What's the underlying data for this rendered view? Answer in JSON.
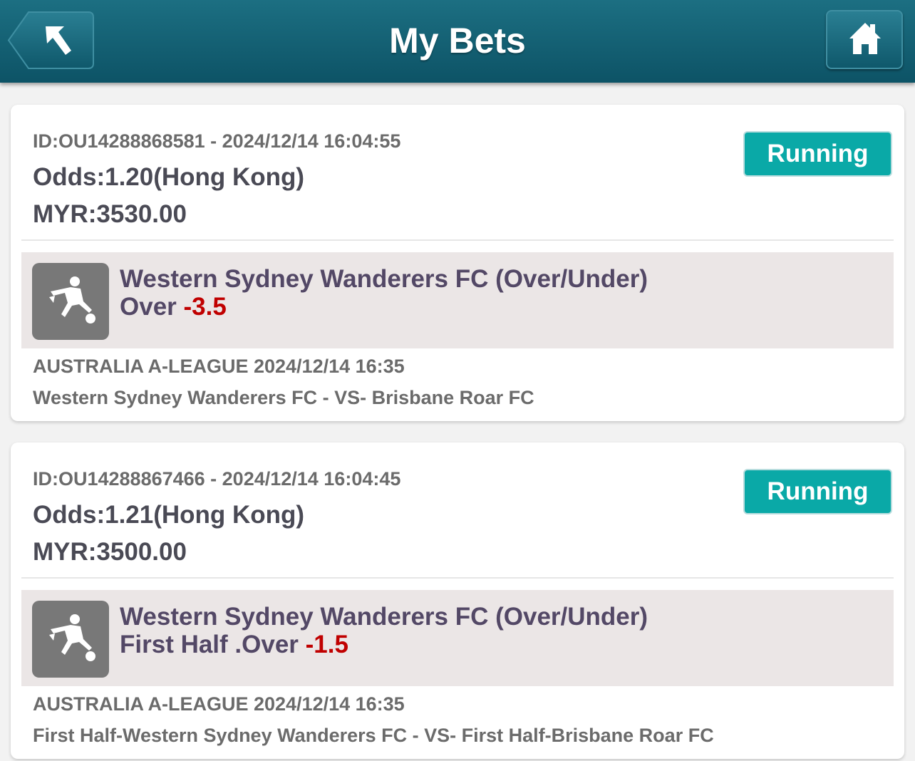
{
  "header": {
    "title": "My Bets",
    "back_icon": "back-arrow-icon",
    "home_icon": "home-icon",
    "color": "#0d5366"
  },
  "bets": [
    {
      "id_line": "ID:OU14288868581 - 2024/12/14 16:04:55",
      "odds": "Odds:1.20(Hong Kong)",
      "amount": "MYR:3530.00",
      "status": "Running",
      "market": "Western Sydney Wanderers FC (Over/Under)",
      "pick": "Over ",
      "line": "-3.5",
      "league": "AUSTRALIA A-LEAGUE 2024/12/14 16:35",
      "match": "Western Sydney Wanderers FC - VS- Brisbane Roar FC",
      "sport_icon": "soccer-player-icon"
    },
    {
      "id_line": "ID:OU14288867466 - 2024/12/14 16:04:45",
      "odds": "Odds:1.21(Hong Kong)",
      "amount": "MYR:3500.00",
      "status": "Running",
      "market": "Western Sydney Wanderers FC (Over/Under)",
      "pick": "First Half .Over ",
      "line": "-1.5",
      "league": "AUSTRALIA A-LEAGUE 2024/12/14 16:35",
      "match": "First Half-Western Sydney Wanderers FC - VS- First Half-Brisbane Roar FC",
      "sport_icon": "soccer-player-icon"
    }
  ],
  "colors": {
    "status_running": "#0aa9a7",
    "line_value": "#c00000"
  }
}
